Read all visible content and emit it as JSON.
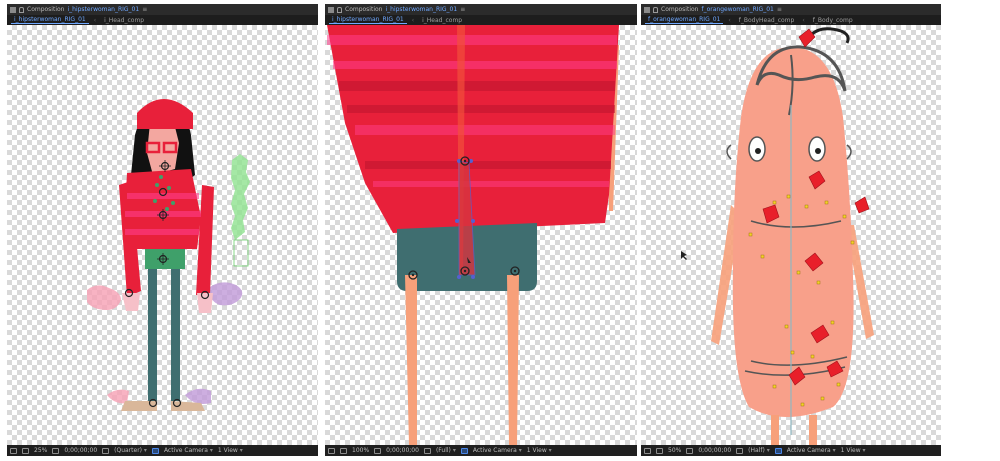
{
  "panels": [
    {
      "title_prefix": "Composition",
      "comp_name": "i_hipsterwoman_RIG_01",
      "tabs": [
        "i_hipsterwoman_RIG_01",
        "i_Head_comp"
      ],
      "zoom": "25%",
      "timecode": "0;00;00;00",
      "resolution": "(Quarter)",
      "camera": "Active Camera",
      "view": "1 View"
    },
    {
      "title_prefix": "Composition",
      "comp_name": "i_hipsterwoman_RIG_01",
      "tabs": [
        "i_hipsterwoman_RIG_01",
        "i_Head_comp"
      ],
      "zoom": "100%",
      "timecode": "0;00;00;00",
      "resolution": "(Full)",
      "camera": "Active Camera",
      "view": "1 View"
    },
    {
      "title_prefix": "Composition",
      "comp_name": "f_orangewoman_RIG_01",
      "tabs": [
        "f_orangewoman_RIG_01",
        "f_BodyHead_comp",
        "f_Body_comp"
      ],
      "zoom": "50%",
      "timecode": "0;00;00;00",
      "resolution": "(Half)",
      "camera": "Active Camera",
      "view": "1 View"
    }
  ],
  "colors": {
    "accent": "#6fa8ff",
    "sweater": "#e8203a",
    "stripe": "#ff3d8a",
    "skirt": "#3f6e70",
    "leg": "#f7a07a",
    "orange_body": "#f8a08a",
    "pin": "#e8202a",
    "handle": "#f5d02a"
  }
}
